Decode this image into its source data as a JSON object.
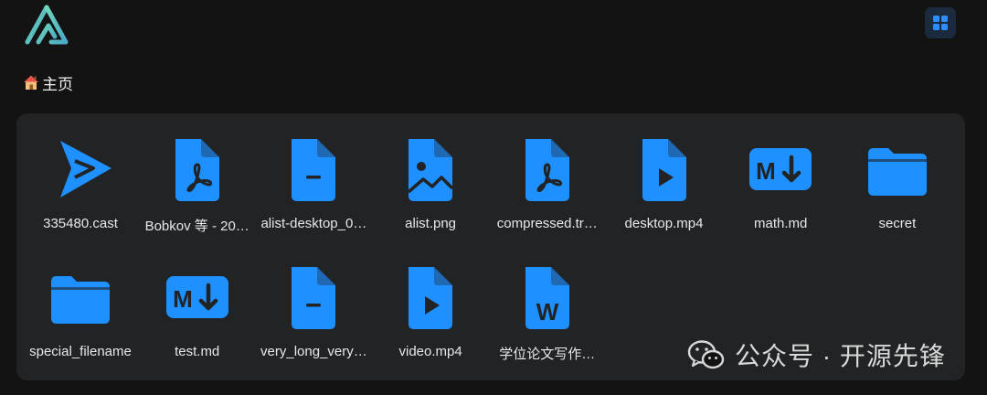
{
  "app": {
    "logo_name": "alist-logo"
  },
  "header": {
    "view_toggle_icon": "grid-view-icon"
  },
  "breadcrumb": {
    "home_icon": "house-icon",
    "label": "主页"
  },
  "colors": {
    "accent": "#1e90ff",
    "panel": "#212325",
    "background": "#131314"
  },
  "files": [
    {
      "name": "335480.cast",
      "icon": "asciinema-icon"
    },
    {
      "name": "Bobkov 等 - 20…",
      "icon": "pdf-file-icon"
    },
    {
      "name": "alist-desktop_0…",
      "icon": "generic-file-icon"
    },
    {
      "name": "alist.png",
      "icon": "image-file-icon"
    },
    {
      "name": "compressed.tr…",
      "icon": "pdf-file-icon"
    },
    {
      "name": "desktop.mp4",
      "icon": "video-file-icon"
    },
    {
      "name": "math.md",
      "icon": "markdown-icon"
    },
    {
      "name": "secret",
      "icon": "folder-icon"
    },
    {
      "name": "special_filename",
      "icon": "folder-icon"
    },
    {
      "name": "test.md",
      "icon": "markdown-icon"
    },
    {
      "name": "very_long_very…",
      "icon": "generic-file-icon"
    },
    {
      "name": "video.mp4",
      "icon": "video-file-icon"
    },
    {
      "name": "学位论文写作…",
      "icon": "word-file-icon"
    }
  ],
  "watermark": {
    "text": "公众号 · 开源先锋",
    "icon": "wechat-icon"
  }
}
